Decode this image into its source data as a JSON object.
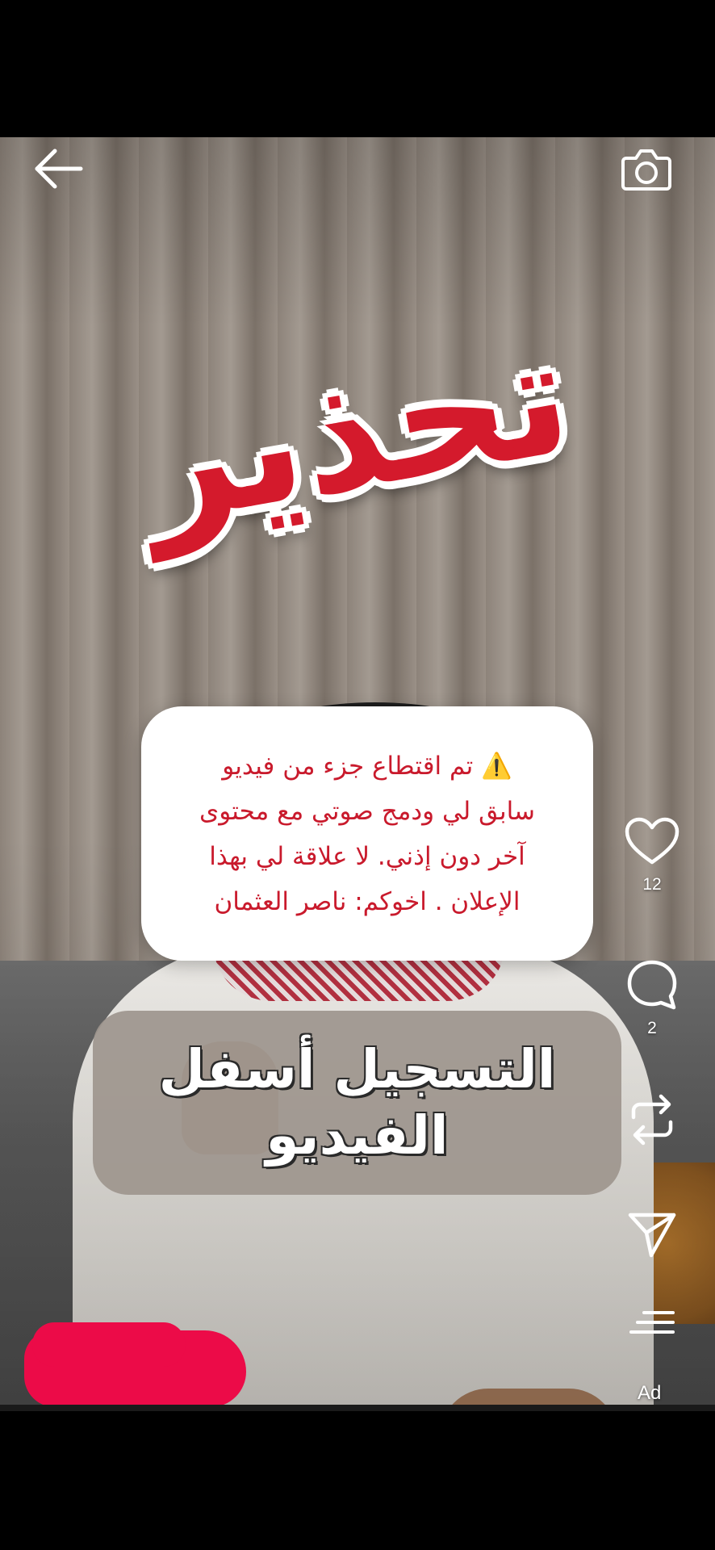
{
  "header": {
    "back_icon": "arrow-left-icon",
    "camera_icon": "camera-icon"
  },
  "overlay": {
    "warning_word": "تحذير",
    "notice_lines": [
      "⚠️ تم اقتطاع جزء من فيديو",
      "سابق لي ودمج صوتي مع محتوى",
      "آخر دون إذني. لا علاقة لي بهذا",
      "الإعلان . اخوكم: ناصر العثمان"
    ],
    "caption_lines": [
      "التسجيل أسفل",
      "الفيديو"
    ]
  },
  "actions": {
    "like_icon": "heart-icon",
    "like_count": "12",
    "comment_icon": "comment-icon",
    "comment_count": "2",
    "repost_icon": "repost-icon",
    "share_icon": "send-icon",
    "more_icon": "menu-lines-icon"
  },
  "ad_label": "Ad",
  "colors": {
    "warning_red": "#d41a2c",
    "notice_text": "#c91a2c",
    "redaction": "#ec0b48"
  }
}
